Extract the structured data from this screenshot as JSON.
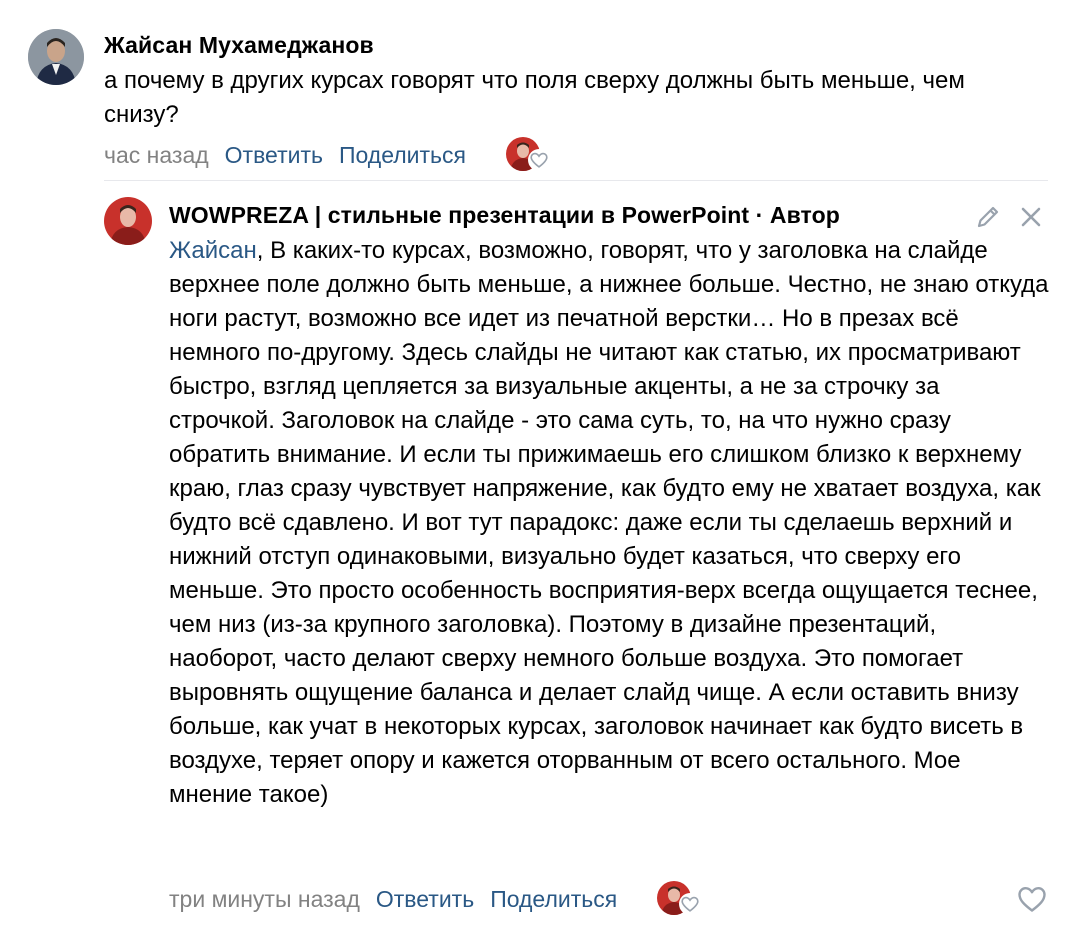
{
  "comment": {
    "author": "Жайсан Мухамеджанов",
    "text": "а почему в других курсах говорят что поля сверху должны быть меньше, чем снизу?",
    "time": "час назад",
    "reply_label": "Ответить",
    "share_label": "Поделиться"
  },
  "reply": {
    "author": "WOWPREZA | стильные презентации в PowerPoint · Автор",
    "mention": "Жайсан",
    "text": ", В каких-то курсах, возможно, говорят, что у заголовка на слайде верхнее поле должно быть меньше, а нижнее больше. Честно, не знаю откуда ноги растут, возможно все идет из печатной верстки… Но в презах всё немного по-другому. Здесь слайды не читают как статью, их просматривают быстро, взгляд цепляется за визуальные акценты, а не за строчку за строчкой. Заголовок на слайде - это сама суть, то, на что нужно сразу обратить внимание. И если ты прижимаешь его слишком близко к верхнему краю, глаз сразу чувствует напряжение, как будто ему не хватает воздуха, как будто всё сдавлено. И вот тут парадокс: даже если ты сделаешь верхний и нижний отступ одинаковыми, визуально будет казаться, что сверху его меньше. Это просто особенность восприятия-верх всегда ощущается теснее, чем низ (из-за крупного заголовка). Поэтому в дизайне презентаций, наоборот, часто делают сверху немного больше воздуха. Это помогает выровнять ощущение баланса и делает слайд чище. А если оставить внизу больше, как учат в некоторых курсах, заголовок начинает как будто висеть в воздухе, теряет опору и кажется оторванным от всего остального. Мое мнение такое)",
    "time": "три минуты назад",
    "reply_label": "Ответить",
    "share_label": "Поделиться"
  },
  "icons": {
    "edit": "pencil-icon",
    "delete": "close-icon",
    "like": "heart-icon"
  },
  "colors": {
    "link": "#2a5885",
    "meta": "#828282",
    "icon": "#99a2ad",
    "reply_avatar_bg": "#c8312b"
  }
}
